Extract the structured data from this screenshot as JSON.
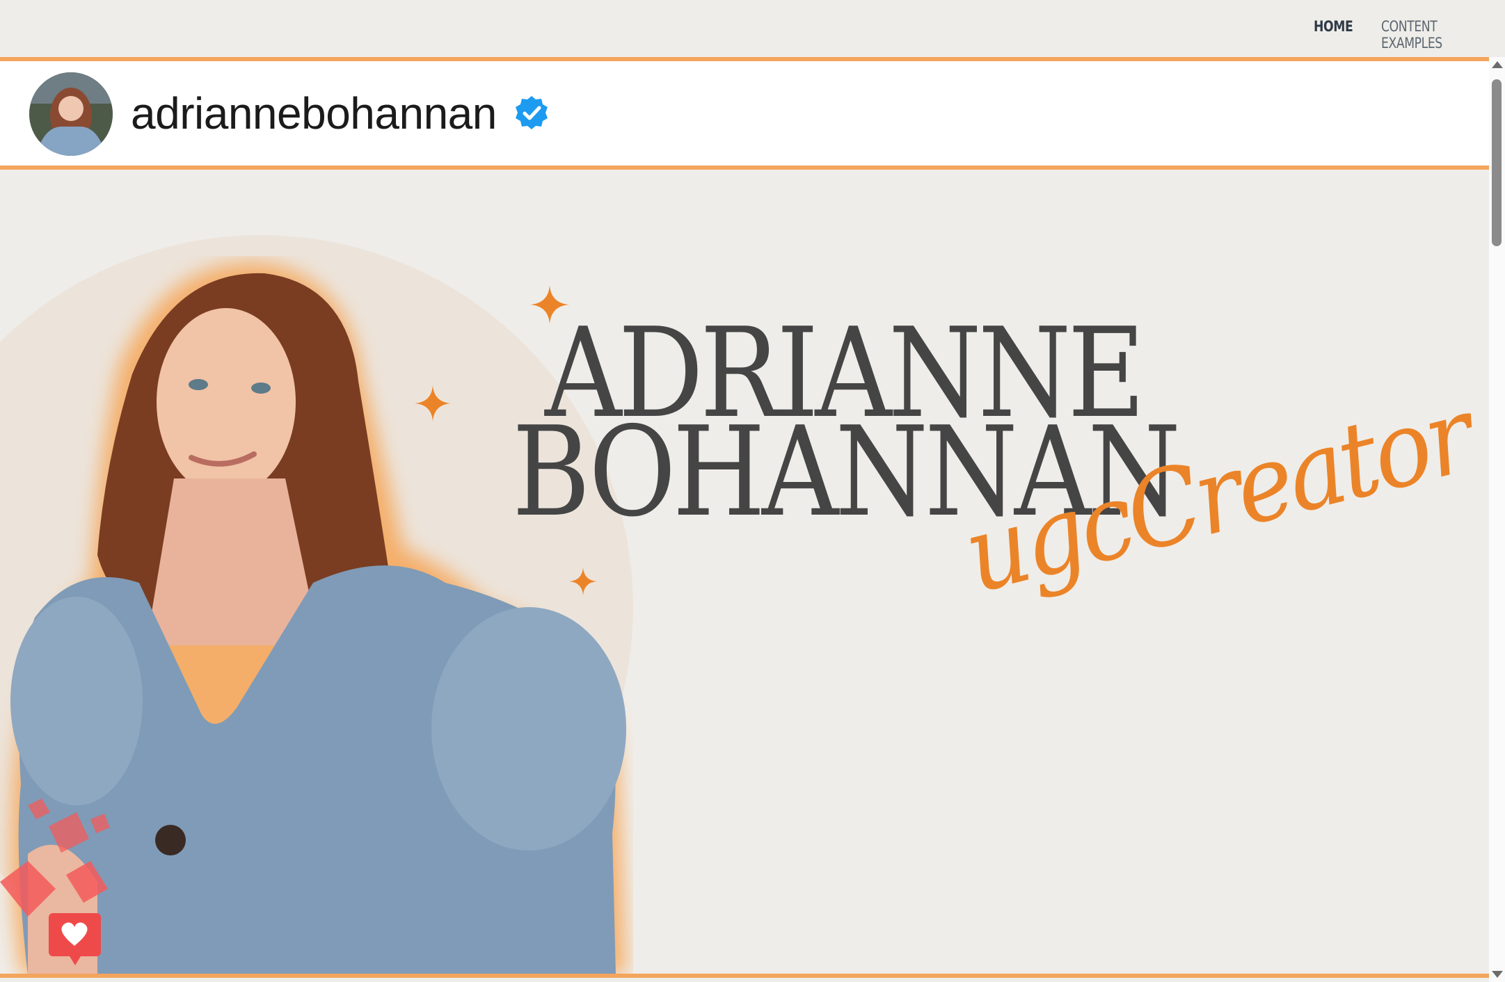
{
  "nav": {
    "items": [
      {
        "label": "HOME",
        "active": true
      },
      {
        "label": "CONTENT EXAMPLES",
        "active": false
      }
    ]
  },
  "profile": {
    "username": "adriannebohannan",
    "verified": true,
    "avatar_icon": "profile-photo"
  },
  "hero": {
    "name_line1": "ADRIANNE",
    "name_line2": "BOHANNAN",
    "tagline": "ugcCreator",
    "decor_icons": [
      "sparkle-icon",
      "heart-notification-icon"
    ]
  },
  "colors": {
    "accent": "#f3a55d",
    "script": "#eb8428",
    "title": "#454545",
    "background": "#efede9",
    "verified_blue": "#1d9bf0",
    "heart_red": "#f45b5b"
  }
}
